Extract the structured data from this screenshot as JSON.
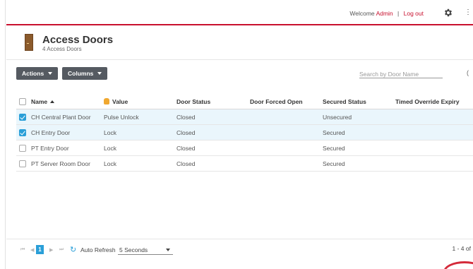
{
  "topbar": {
    "welcome_prefix": "Welcome",
    "user": "Admin",
    "separator": "|",
    "logout": "Log out",
    "more_glyph": "⋮"
  },
  "page": {
    "title": "Access Doors",
    "subtitle": "4 Access Doors"
  },
  "toolbar": {
    "actions_label": "Actions",
    "columns_label": "Columns",
    "search_placeholder": "Search by Door Name",
    "search_icon_glyph": "("
  },
  "table": {
    "columns": {
      "name": "Name",
      "value": "Value",
      "status": "Door Status",
      "forced": "Door Forced Open",
      "secured": "Secured Status",
      "timed": "Timed Override Expiry"
    },
    "rows": [
      {
        "name": "CH Central Plant Door",
        "value": "Pulse Unlock",
        "status": "Closed",
        "forced": "",
        "secured": "Unsecured",
        "timed": "",
        "checked": true
      },
      {
        "name": "CH Entry Door",
        "value": "Lock",
        "status": "Closed",
        "forced": "",
        "secured": "Secured",
        "timed": "",
        "checked": true
      },
      {
        "name": "PT Entry Door",
        "value": "Lock",
        "status": "Closed",
        "forced": "",
        "secured": "Secured",
        "timed": "",
        "checked": false
      },
      {
        "name": "PT Server Room Door",
        "value": "Lock",
        "status": "Closed",
        "forced": "",
        "secured": "Secured",
        "timed": "",
        "checked": false
      }
    ]
  },
  "pager": {
    "first": "⏮",
    "prev": "◀",
    "page": "1",
    "next": "▶",
    "last": "⏭",
    "refresh_glyph": "↻",
    "auto_refresh_label": "Auto Refresh",
    "interval": "5 Seconds",
    "range": "1 - 4 of"
  },
  "colors": {
    "accent_red": "#c8102e",
    "accent_blue": "#2a9fd8",
    "button_gray": "#555a61"
  }
}
